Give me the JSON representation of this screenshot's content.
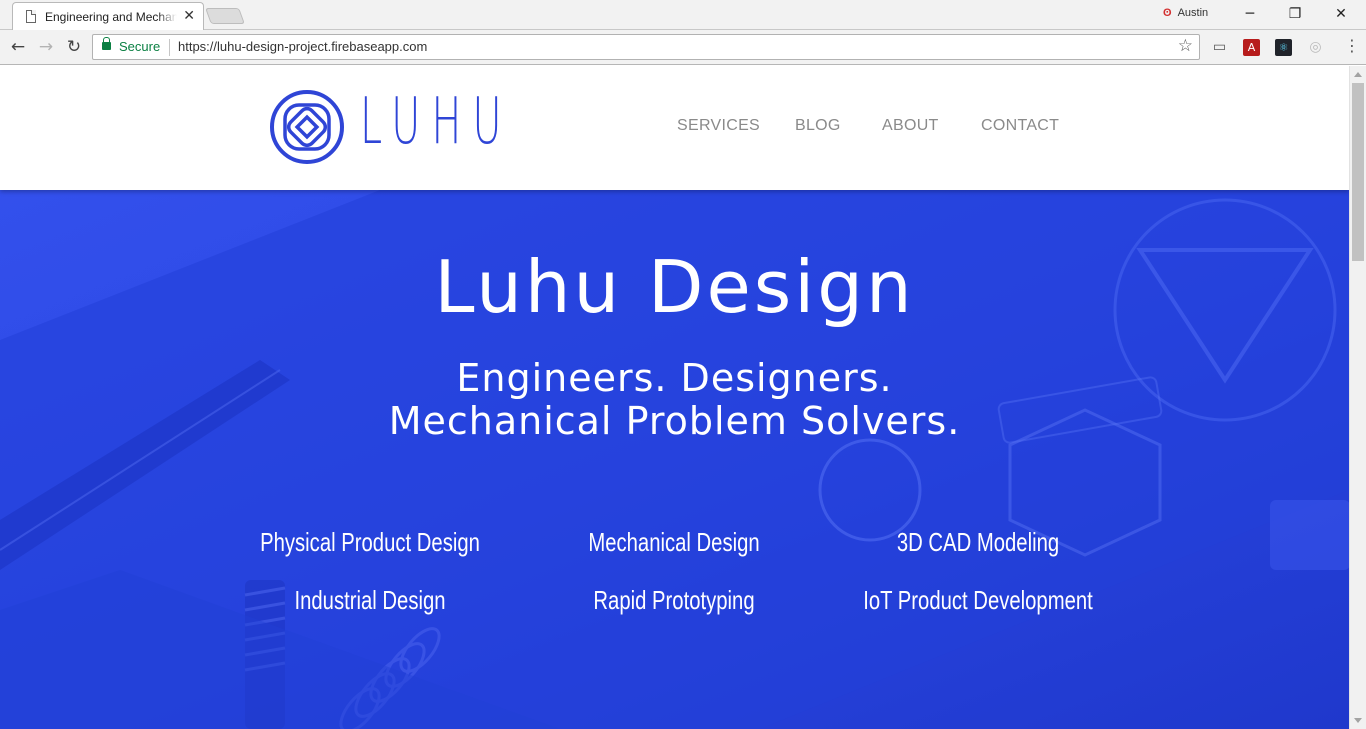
{
  "browser": {
    "tab_title": "Engineering and Mechanical Design",
    "profile_name": "Austin",
    "secure_label": "Secure",
    "url": "https://luhu-design-project.firebaseapp.com"
  },
  "header": {
    "logo_text": "LUHU",
    "nav": [
      "SERVICES",
      "BLOG",
      "ABOUT",
      "CONTACT"
    ]
  },
  "hero": {
    "title": "Luhu Design",
    "subtitle_line1": "Engineers. Designers.",
    "subtitle_line2": "Mechanical Problem Solvers.",
    "services": [
      "Physical Product Design",
      "Mechanical Design",
      "3D CAD Modeling",
      "Industrial Design",
      "Rapid Prototyping",
      "IoT Product Development"
    ]
  },
  "colors": {
    "brand_blue": "#2f45d6",
    "hero_blue": "#2947e6",
    "nav_gray": "#8a8a8a",
    "secure_green": "#0b8043"
  }
}
